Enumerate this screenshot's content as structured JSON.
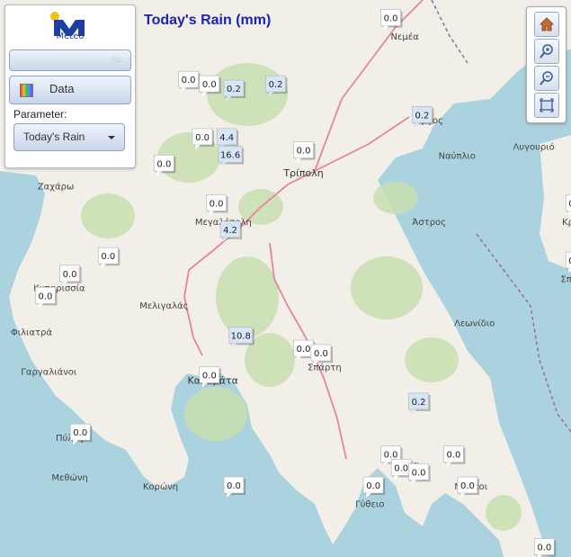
{
  "panel": {
    "logo_text": "Meteo",
    "data_label": "Data",
    "parameter_label": "Parameter:",
    "parameter_value": "Today's Rain"
  },
  "title": "Today's Rain (mm)",
  "places": [
    {
      "name": "Νεμέα",
      "lon": 22.66,
      "lat": 37.82
    },
    {
      "name": "Άργος",
      "lon": 22.73,
      "lat": 37.63
    },
    {
      "name": "Λυγουριό",
      "lon": 23.03,
      "lat": 37.57
    },
    {
      "name": "Ναύπλιο",
      "lon": 22.81,
      "lat": 37.55
    },
    {
      "name": "Τρίπολη",
      "lon": 22.37,
      "lat": 37.51
    },
    {
      "name": "Ζαχάρω",
      "lon": 21.66,
      "lat": 37.48
    },
    {
      "name": "Κρανίδι",
      "lon": 23.16,
      "lat": 37.4
    },
    {
      "name": "Μεγαλόπολη",
      "lon": 22.14,
      "lat": 37.4
    },
    {
      "name": "Άστρος",
      "lon": 22.73,
      "lat": 37.4
    },
    {
      "name": "Σπέτσες",
      "lon": 23.16,
      "lat": 37.27
    },
    {
      "name": "Κυπαρισσία",
      "lon": 21.67,
      "lat": 37.25
    },
    {
      "name": "Μελιγαλάς",
      "lon": 21.97,
      "lat": 37.21
    },
    {
      "name": "Φιλιατρά",
      "lon": 21.59,
      "lat": 37.15
    },
    {
      "name": "Λεωνίδιο",
      "lon": 22.86,
      "lat": 37.17
    },
    {
      "name": "Γαργαλιάνοι",
      "lon": 21.64,
      "lat": 37.06
    },
    {
      "name": "Σπάρτη",
      "lon": 22.43,
      "lat": 37.07
    },
    {
      "name": "Καλαμάτα",
      "lon": 22.11,
      "lat": 37.04
    },
    {
      "name": "Πύλος",
      "lon": 21.7,
      "lat": 36.91
    },
    {
      "name": "Σκάλα",
      "lon": 22.66,
      "lat": 36.85
    },
    {
      "name": "Μεθώνη",
      "lon": 21.7,
      "lat": 36.82
    },
    {
      "name": "Μολάοι",
      "lon": 22.85,
      "lat": 36.8
    },
    {
      "name": "Κορώνη",
      "lon": 21.96,
      "lat": 36.8
    },
    {
      "name": "Γύθειο",
      "lon": 22.56,
      "lat": 36.76
    }
  ],
  "stations": [
    {
      "value": "0.0",
      "lon": 22.62,
      "lat": 37.87
    },
    {
      "value": "0.0",
      "lon": 22.04,
      "lat": 37.73
    },
    {
      "value": "0.0",
      "lon": 22.1,
      "lat": 37.72
    },
    {
      "value": "0.2",
      "lon": 22.17,
      "lat": 37.71
    },
    {
      "value": "0.2",
      "lon": 22.29,
      "lat": 37.72
    },
    {
      "value": "0.2",
      "lon": 22.71,
      "lat": 37.65
    },
    {
      "value": "0.0",
      "lon": 22.08,
      "lat": 37.6
    },
    {
      "value": "4.4",
      "lon": 22.15,
      "lat": 37.6
    },
    {
      "value": "16.6",
      "lon": 22.16,
      "lat": 37.56
    },
    {
      "value": "0.0",
      "lon": 22.37,
      "lat": 37.57
    },
    {
      "value": "0.0",
      "lon": 21.97,
      "lat": 37.54
    },
    {
      "value": "0.0",
      "lon": 23.19,
      "lat": 37.51
    },
    {
      "value": "0.0",
      "lon": 23.15,
      "lat": 37.45
    },
    {
      "value": "0.0",
      "lon": 22.12,
      "lat": 37.45
    },
    {
      "value": "4.2",
      "lon": 22.16,
      "lat": 37.39
    },
    {
      "value": "0.0",
      "lon": 21.81,
      "lat": 37.33
    },
    {
      "value": "0.0",
      "lon": 23.15,
      "lat": 37.32
    },
    {
      "value": "0.0",
      "lon": 21.7,
      "lat": 37.29
    },
    {
      "value": "0.0",
      "lon": 21.63,
      "lat": 37.24
    },
    {
      "value": "10.8",
      "lon": 22.19,
      "lat": 37.15
    },
    {
      "value": "0.0",
      "lon": 22.37,
      "lat": 37.12
    },
    {
      "value": "0.0",
      "lon": 22.42,
      "lat": 37.11
    },
    {
      "value": "0.0",
      "lon": 22.1,
      "lat": 37.06
    },
    {
      "value": "0.2",
      "lon": 22.7,
      "lat": 37.0
    },
    {
      "value": "0.0",
      "lon": 21.73,
      "lat": 36.93
    },
    {
      "value": "0.0",
      "lon": 22.62,
      "lat": 36.88
    },
    {
      "value": "0.0",
      "lon": 22.8,
      "lat": 36.88
    },
    {
      "value": "0.0",
      "lon": 22.65,
      "lat": 36.85
    },
    {
      "value": "0.0",
      "lon": 22.7,
      "lat": 36.84
    },
    {
      "value": "0.0",
      "lon": 22.17,
      "lat": 36.81
    },
    {
      "value": "0.0",
      "lon": 22.57,
      "lat": 36.81
    },
    {
      "value": "0.0",
      "lon": 22.84,
      "lat": 36.81
    },
    {
      "value": "0.0",
      "lon": 23.06,
      "lat": 36.67
    }
  ],
  "colors": {
    "sea": "#aad3df",
    "land": "#f2efe9",
    "forest": "#c8dfb0",
    "road": "#e8849a",
    "border": "#9b6b9e",
    "accent": "#1a23b8"
  },
  "icons": {
    "collapse": "arrow-left-icon",
    "data": "rainbow-icon",
    "home": "home-icon",
    "zoom_in": "zoom-in-icon",
    "zoom_out": "zoom-out-icon",
    "extent": "full-extent-icon"
  }
}
